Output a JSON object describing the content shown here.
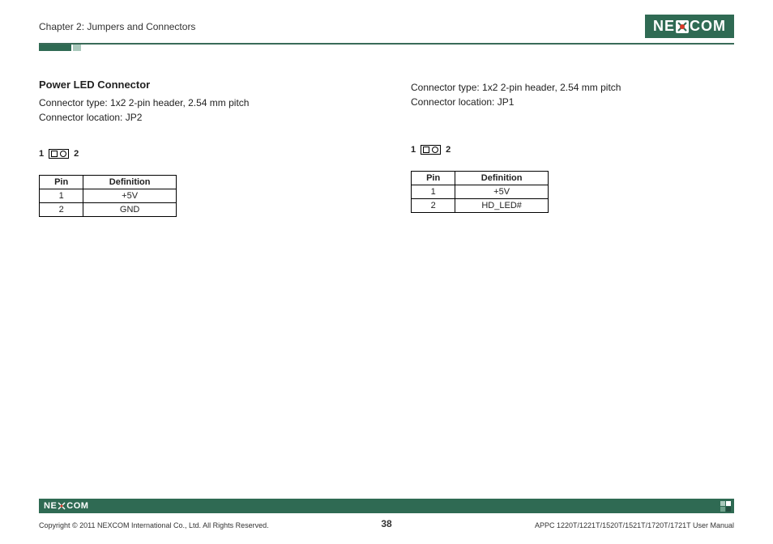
{
  "header": {
    "chapter": "Chapter 2: Jumpers and Connectors",
    "logo_left": "NE",
    "logo_right": "COM"
  },
  "left": {
    "title": "Power LED Connector",
    "type": "Connector type: 1x2 2-pin header, 2.54 mm pitch",
    "location": "Connector location: JP2",
    "pinLeft": "1",
    "pinRight": "2",
    "table": {
      "hdrPin": "Pin",
      "hdrDef": "Definition",
      "rows": [
        {
          "pin": "1",
          "def": "+5V"
        },
        {
          "pin": "2",
          "def": "GND"
        }
      ]
    }
  },
  "right": {
    "type": "Connector type: 1x2 2-pin header, 2.54 mm pitch",
    "location": "Connector location: JP1",
    "pinLeft": "1",
    "pinRight": "2",
    "table": {
      "hdrPin": "Pin",
      "hdrDef": "Definition",
      "rows": [
        {
          "pin": "1",
          "def": "+5V"
        },
        {
          "pin": "2",
          "def": "HD_LED#"
        }
      ]
    }
  },
  "footer": {
    "logo_left": "NE",
    "logo_right": "COM",
    "copyright": "Copyright © 2011 NEXCOM International Co., Ltd. All Rights Reserved.",
    "page": "38",
    "manual": "APPC 1220T/1221T/1520T/1521T/1720T/1721T User Manual"
  }
}
